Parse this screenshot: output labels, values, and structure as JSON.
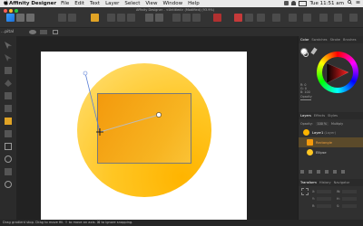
{
  "menubar": {
    "app_name": "Affinity Designer",
    "items": [
      "File",
      "Edit",
      "Text",
      "Layer",
      "Select",
      "View",
      "Window",
      "Help"
    ],
    "clock": "Tue 11:51 am"
  },
  "document": {
    "title": "Affinity Designer - <Untitled> (Modified) (93.9%)"
  },
  "context": {
    "label": "...pital"
  },
  "panels": {
    "top_tabs": [
      "Color",
      "Swatches",
      "Stroke",
      "Brushes"
    ],
    "color_readout": {
      "r": "R: 0",
      "g": "G: 0",
      "b": "B: 100",
      "opacity_label": "Opacity"
    },
    "layers_tabs": [
      "Layers",
      "Effects",
      "Styles"
    ],
    "layer_controls": {
      "opacity": "Opacity:",
      "opacity_value": "100 %",
      "blend": "Multiply"
    },
    "layers": [
      {
        "name": "Layer1",
        "note": "(Layer)",
        "color": "#ffb400"
      },
      {
        "name": "Rectangle",
        "note": "",
        "color": "#f39a0d"
      },
      {
        "name": "Ellipse",
        "note": "",
        "color": "#ffc623"
      }
    ],
    "bottom_tabs": [
      "Transform",
      "History",
      "Navigator"
    ],
    "transform": {
      "x": "X:",
      "y": "Y:",
      "w": "W:",
      "h": "H:",
      "r": "R:",
      "s": "S:"
    }
  },
  "statusbar": {
    "text": "Drag gradient stop. Drag to move fill. ⇧ to move an axis. ⌘ to ignore snapping."
  },
  "colors": {
    "accent_gradient_start": "#f39a0d",
    "accent_gradient_end": "#ffe07a",
    "ui_dark": "#2b2b2b"
  }
}
